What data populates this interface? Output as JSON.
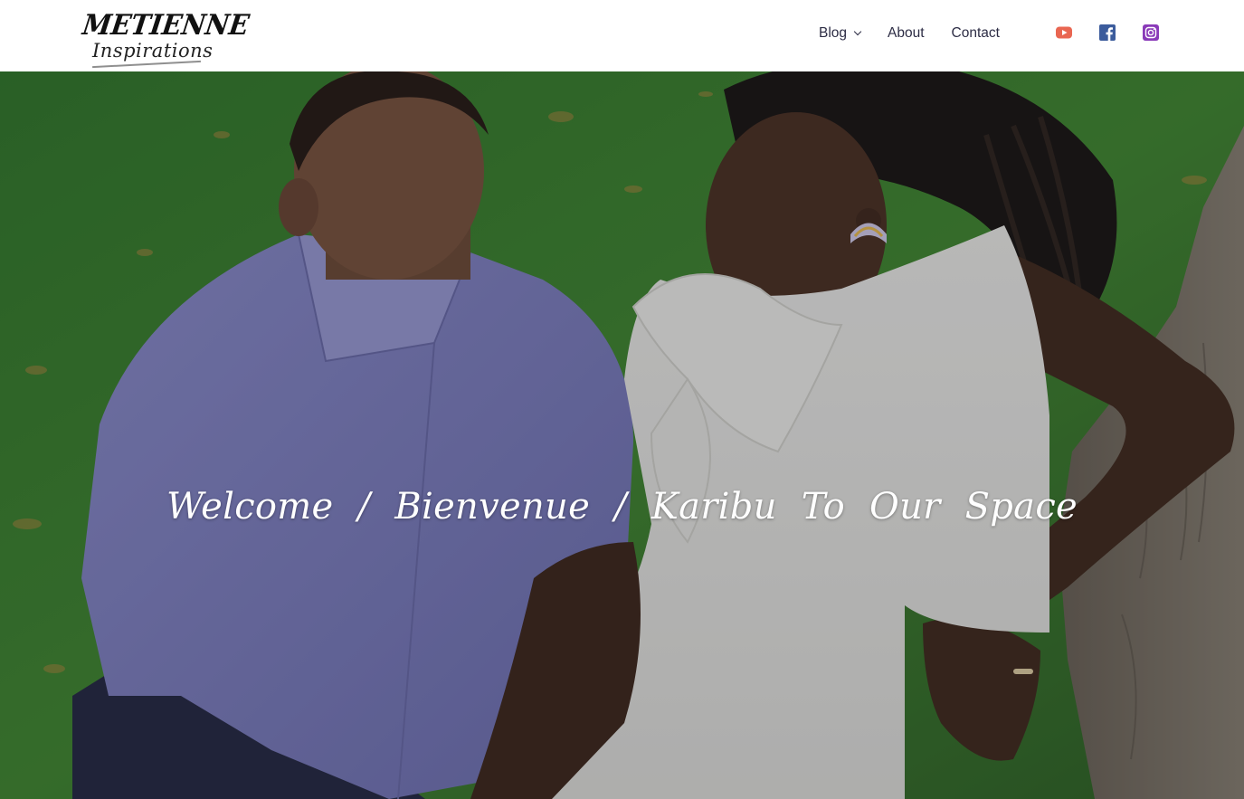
{
  "brand": {
    "logo_line1": "METIENNE",
    "logo_line2": "Inspirations"
  },
  "nav": {
    "items": [
      {
        "label": "Blog",
        "has_dropdown": true
      },
      {
        "label": "About",
        "has_dropdown": false
      },
      {
        "label": "Contact",
        "has_dropdown": false
      }
    ]
  },
  "social": [
    {
      "name": "youtube-icon",
      "color": "#e96651"
    },
    {
      "name": "facebook-icon",
      "color": "#3c5c9c"
    },
    {
      "name": "instagram-icon",
      "color": "#8a3ab9"
    }
  ],
  "hero": {
    "title": "Welcome / Bienvenue / Karibu To Our Space",
    "image_subject": "photo of couple sitting on grass near a tree"
  },
  "colors": {
    "header_bg": "#ffffff",
    "nav_text": "#2d2d45",
    "hero_title": "#ffffff"
  }
}
